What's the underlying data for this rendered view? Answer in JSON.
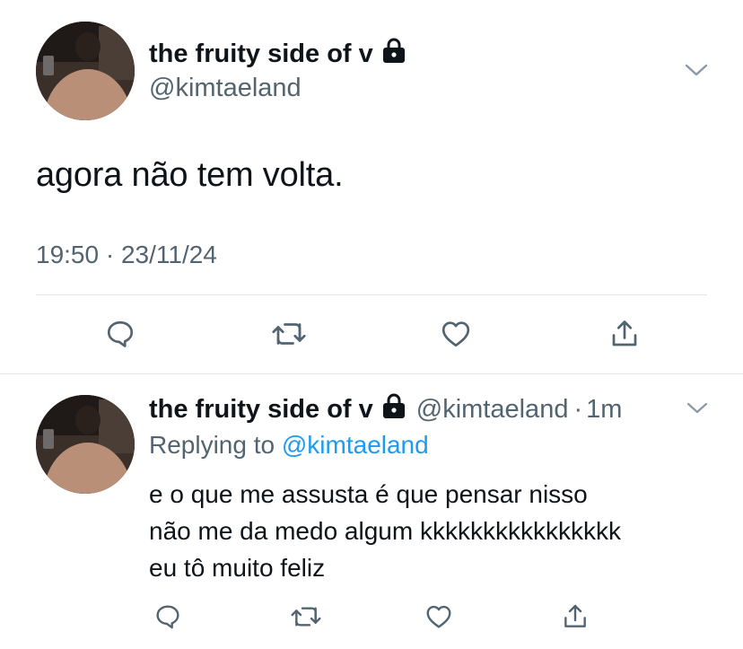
{
  "main_tweet": {
    "display_name": "the fruity side of v",
    "handle": "@kimtaeland",
    "text": "agora não tem volta.",
    "time": "19:50",
    "separator": "·",
    "date": "23/11/24"
  },
  "reply_tweet": {
    "display_name": "the fruity side of v",
    "handle": "@kimtaeland",
    "separator": "·",
    "age": "1m",
    "replying_prefix": "Replying to",
    "replying_to": "@kimtaeland",
    "lines": [
      "e o que me assusta é que pensar nisso",
      "não me da medo algum kkkkkkkkkkkkkkkk",
      "eu tô muito feliz"
    ]
  },
  "colors": {
    "text": "#0f1419",
    "secondary": "#536471",
    "link": "#1d9bf0",
    "divider": "#e1e4e8"
  },
  "icons": [
    "lock-icon",
    "chevron-down-icon",
    "reply-icon",
    "retweet-icon",
    "like-icon",
    "share-icon"
  ]
}
